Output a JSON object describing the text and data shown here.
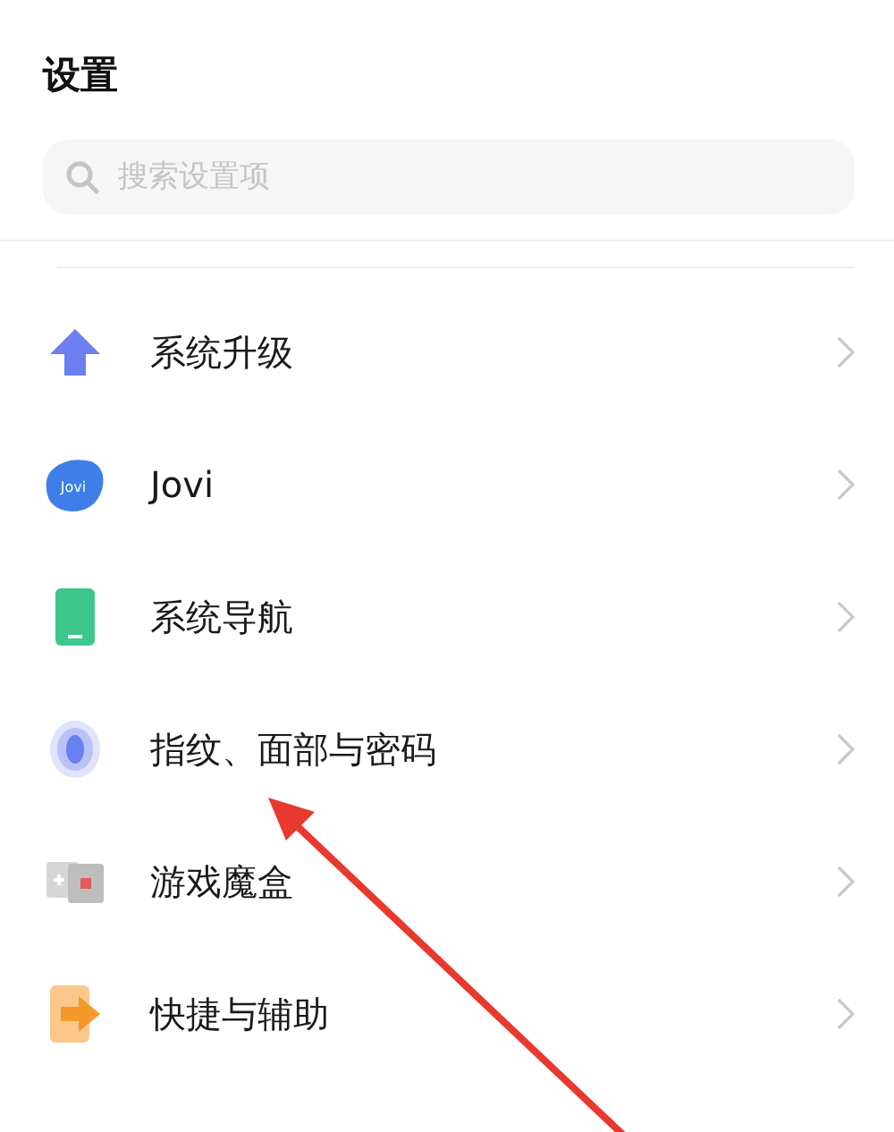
{
  "header": {
    "title": "设置"
  },
  "search": {
    "placeholder": "搜索设置项"
  },
  "items": [
    {
      "kind": "upgrade",
      "label": "系统升级"
    },
    {
      "kind": "assistant",
      "label": "Jovi",
      "icon_text": "Jovi"
    },
    {
      "kind": "navigation",
      "label": "系统导航"
    },
    {
      "kind": "fingerprint",
      "label": "指纹、面部与密码"
    },
    {
      "kind": "game",
      "label": "游戏魔盒"
    },
    {
      "kind": "shortcut",
      "label": "快捷与辅助"
    }
  ],
  "overlays": [
    {
      "kind": "arrow"
    }
  ]
}
